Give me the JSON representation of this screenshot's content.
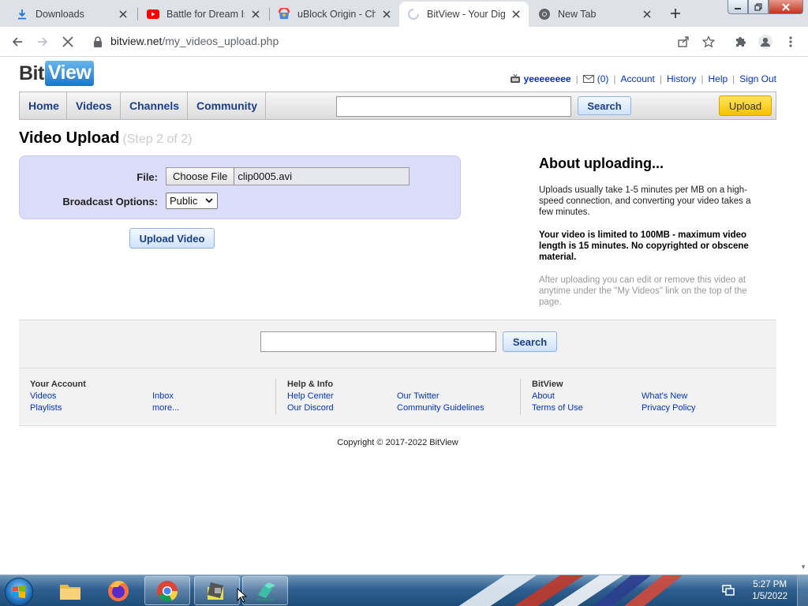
{
  "browser": {
    "tabs": [
      {
        "title": "Downloads",
        "icon": "download-icon",
        "active": false
      },
      {
        "title": "Battle for Dream Isl",
        "icon": "youtube-icon",
        "active": false
      },
      {
        "title": "uBlock Origin - Chr",
        "icon": "webstore-icon",
        "active": false
      },
      {
        "title": "BitView - Your Digi",
        "icon": "loading-spinner-icon",
        "active": true
      },
      {
        "title": "New Tab",
        "icon": "chrome-icon",
        "active": false
      }
    ],
    "url_host": "bitview.net",
    "url_path": "/my_videos_upload.php"
  },
  "site": {
    "logo_part1": "Bit",
    "logo_part2": "View",
    "user": {
      "username": "yeeeeeeee",
      "inbox_count": "(0)",
      "links": [
        "Account",
        "History",
        "Help",
        "Sign Out"
      ]
    },
    "nav": [
      "Home",
      "Videos",
      "Channels",
      "Community"
    ],
    "search_button": "Search",
    "upload_button": "Upload"
  },
  "upload": {
    "title": "Video Upload",
    "step": "(Step 2 of 2)",
    "file_label": "File:",
    "choose_file": "Choose File",
    "file_name": "clip0005.avi",
    "broadcast_label": "Broadcast Options:",
    "broadcast_value": "Public",
    "submit": "Upload Video"
  },
  "about": {
    "heading": "About uploading...",
    "p1": "Uploads usually take 1-5 minutes per MB on a high-speed connection, and converting your video takes a few minutes.",
    "p2": "Your video is limited to 100MB - maximum video length is 15 minutes. No copyrighted or obscene material.",
    "p3": "After uploading you can edit or remove this video at anytime under the \"My Videos\" link on the top of the page."
  },
  "footer": {
    "search_button": "Search",
    "columns": [
      {
        "heading": "Your Account",
        "links": [
          "Videos",
          "Inbox",
          "Playlists",
          "more..."
        ]
      },
      {
        "heading": "Help & Info",
        "links": [
          "Help Center",
          "Our Twitter",
          "Our Discord",
          "Community Guidelines"
        ]
      },
      {
        "heading": "BitView",
        "links": [
          "About",
          "What's New",
          "Terms of Use",
          "Privacy Policy"
        ]
      }
    ],
    "copyright": "Copyright © 2017-2022 BitView"
  },
  "taskbar": {
    "time": "5:27 PM",
    "date": "1/5/2022"
  }
}
